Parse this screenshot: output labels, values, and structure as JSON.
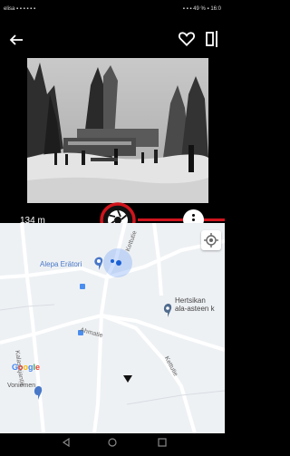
{
  "status": {
    "left": "elisa ▪ ▪ ▪ ▪ ▪ ▪",
    "right": "▪ ▪ ▪ 49 % ▪ 16:0"
  },
  "photo": {
    "distance": "134 m"
  },
  "map": {
    "poi_alepa": "Alepa Erätori",
    "poi_school_line1": "Hertsikan",
    "poi_school_line2": "ala-asteen k",
    "street_1": "Kettutie",
    "street_2": "Ahmatie",
    "street_3": "Kettutie",
    "street_4": "Kalastajantie",
    "corner_text": "Voniemen",
    "google": [
      "G",
      "o",
      "o",
      "g",
      "l",
      "e"
    ]
  },
  "colors": {
    "accent_red": "#d0141c",
    "location_blue": "#4285f4",
    "google_letters": [
      "#4285f4",
      "#ea4335",
      "#fbbc05",
      "#4285f4",
      "#34a853",
      "#ea4335"
    ]
  },
  "icons": [
    "back-arrow-icon",
    "heart-icon",
    "compare-icon",
    "camera-shutter-icon",
    "more-icon",
    "locate-icon",
    "location-pin-icon",
    "bus-stop-icon",
    "direction-marker-icon",
    "nav-back-icon",
    "nav-home-icon",
    "nav-recents-icon"
  ]
}
